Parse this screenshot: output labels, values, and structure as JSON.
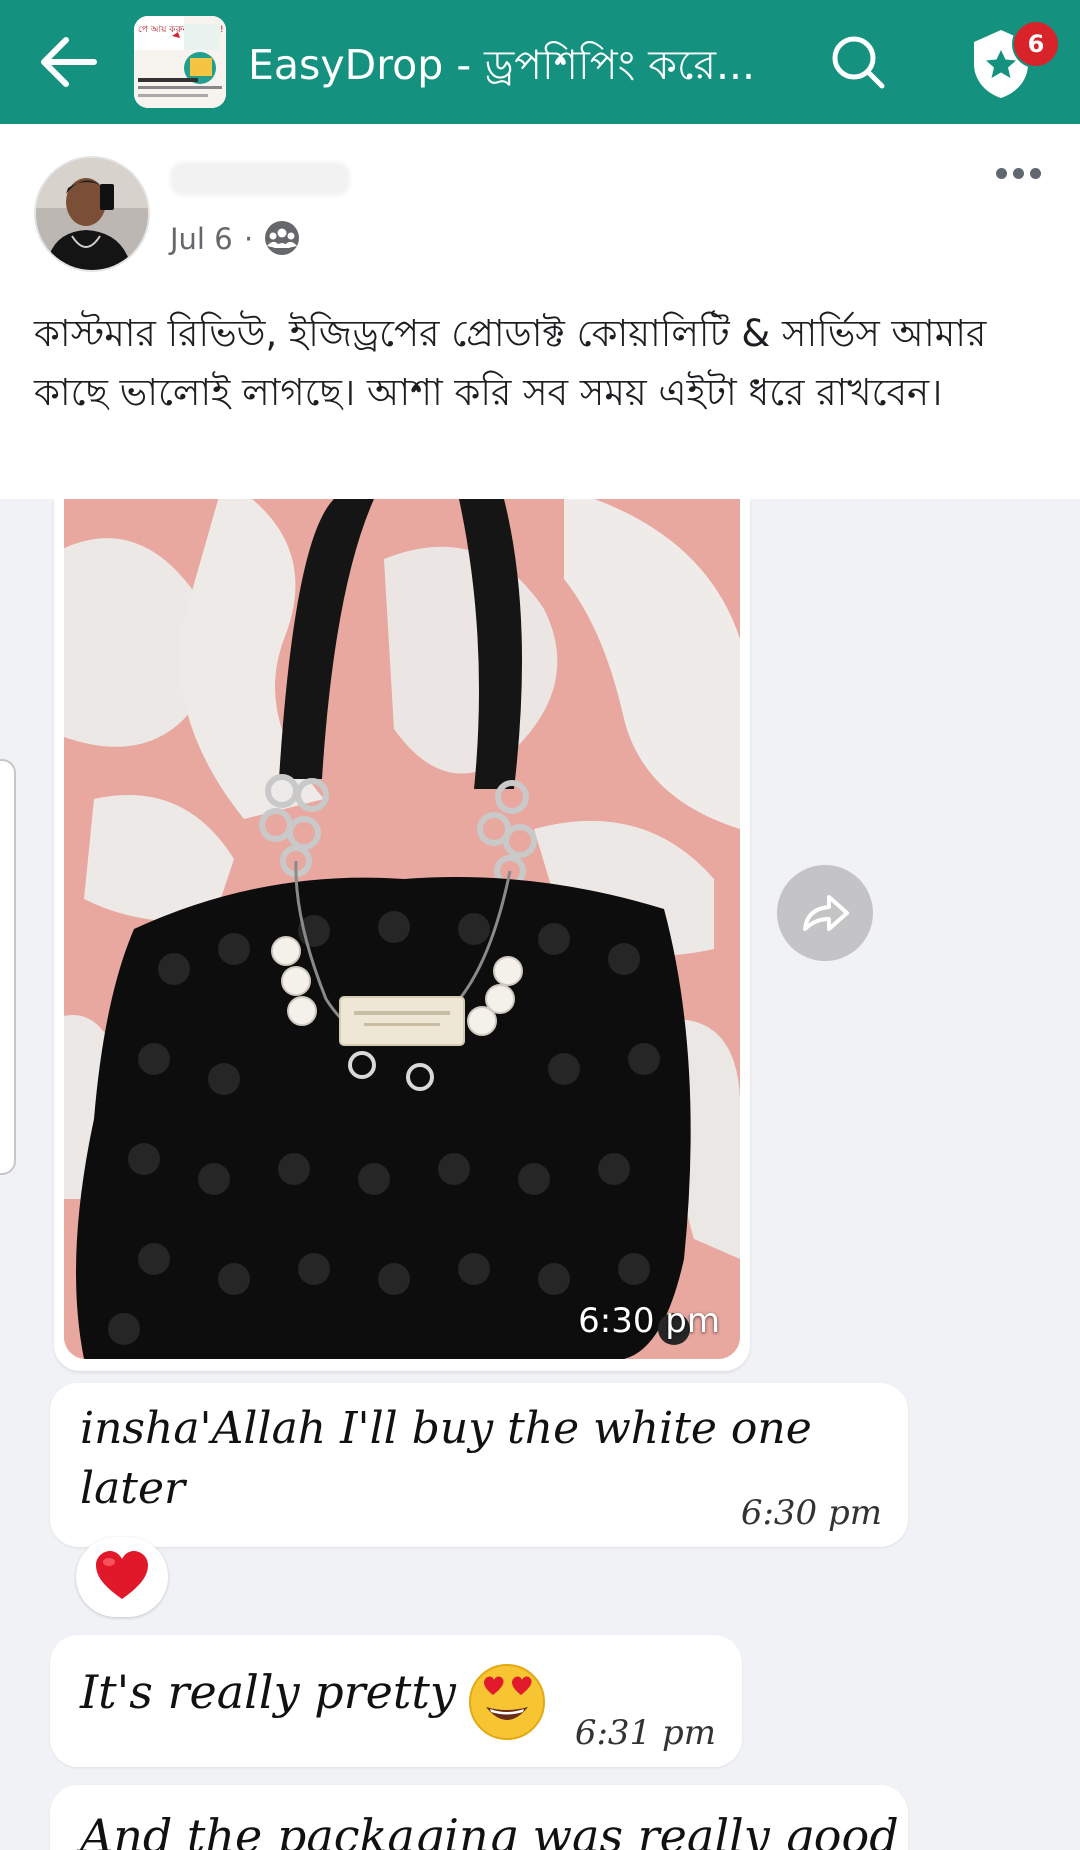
{
  "topbar": {
    "title": "EasyDrop - ড্রপশিপিং করে...",
    "notification_count": "6",
    "thumbnail_text": "পে আয় করুন ই ছাড়াই!"
  },
  "post": {
    "date": "Jul 6",
    "separator": "·",
    "text": "কাস্টমার রিভিউ, ইজিড্রপের প্রোডাক্ট কোয়ালিটি & সার্ভিস আমার কাছে ভালোই লাগছে। আশা করি সব সময় এইটা ধরে রাখবেন।"
  },
  "screenshot": {
    "photo_time": "6:30 pm",
    "messages": [
      {
        "text": "insha'Allah I'll buy the white one later",
        "time": "6:30 pm"
      },
      {
        "text": "It's really pretty",
        "time": "6:31 pm"
      },
      {
        "text": "And the packaging was really good"
      }
    ]
  },
  "colors": {
    "topbar": "#14917f",
    "badge": "#d8232a"
  }
}
